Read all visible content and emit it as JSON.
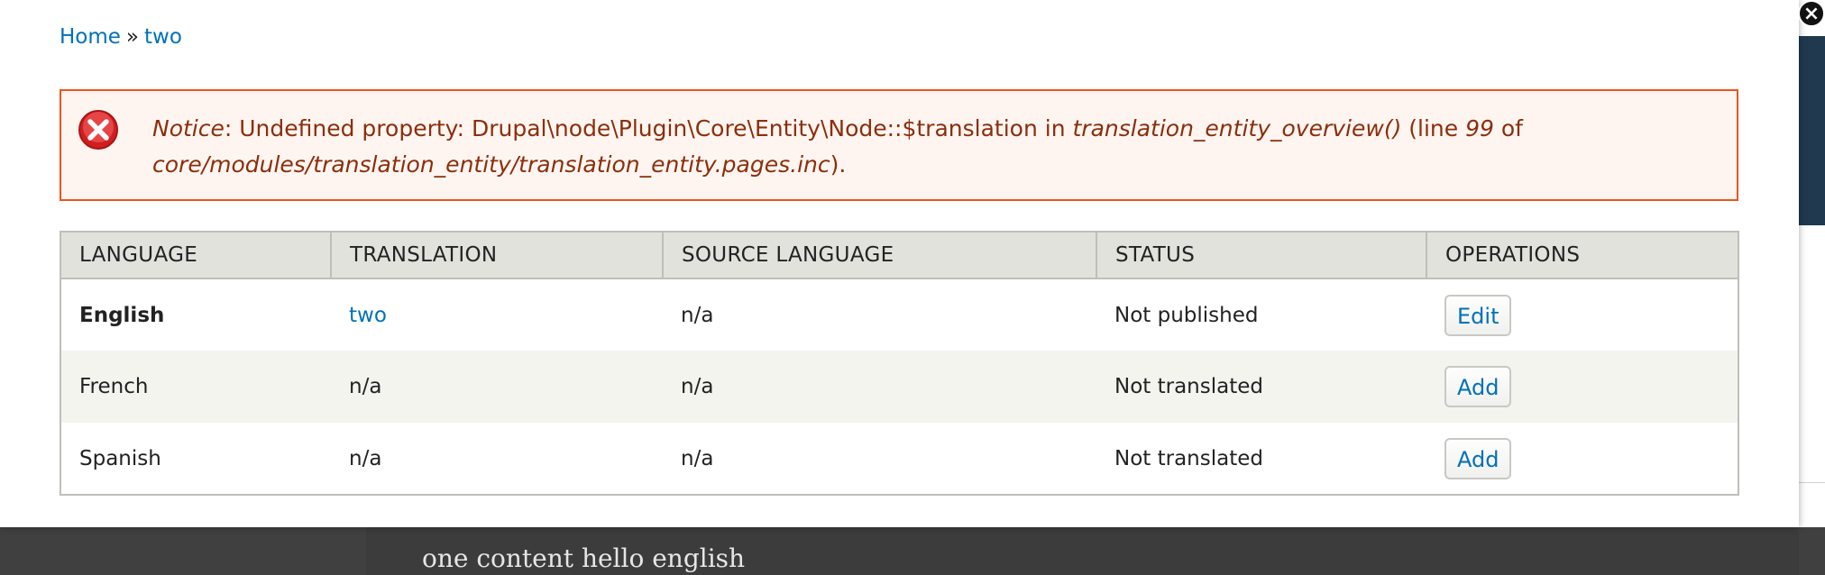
{
  "breadcrumb": {
    "home": "Home",
    "separator": "»",
    "current": "two"
  },
  "error": {
    "notice": "Notice",
    "message_part1": ": Undefined property: Drupal\\node\\Plugin\\Core\\Entity\\Node::$translation in ",
    "function": "translation_entity_overview()",
    "line_prefix": " (line ",
    "line": "99",
    "of": " of ",
    "file": "core/modules/translation_entity/translation_entity.pages.inc",
    "end": ")."
  },
  "table": {
    "headers": {
      "language": "Language",
      "translation": "Translation",
      "source_language": "Source language",
      "status": "Status",
      "operations": "Operations"
    },
    "rows": [
      {
        "language": "English",
        "translation": "two",
        "source": "n/a",
        "status": "Not published",
        "operation": "Edit"
      },
      {
        "language": "French",
        "translation": "n/a",
        "source": "n/a",
        "status": "Not translated",
        "operation": "Add"
      },
      {
        "language": "Spanish",
        "translation": "n/a",
        "source": "n/a",
        "status": "Not translated",
        "operation": "Add"
      }
    ]
  },
  "background": {
    "content_text": "one content hello english"
  },
  "overlay": {
    "close_glyph": "×"
  },
  "colors": {
    "link": "#0071b8",
    "error_border": "#ed541d",
    "error_bg": "#fef5f1",
    "error_text": "#8c2e0b",
    "table_header_bg": "#e1e2dc"
  }
}
